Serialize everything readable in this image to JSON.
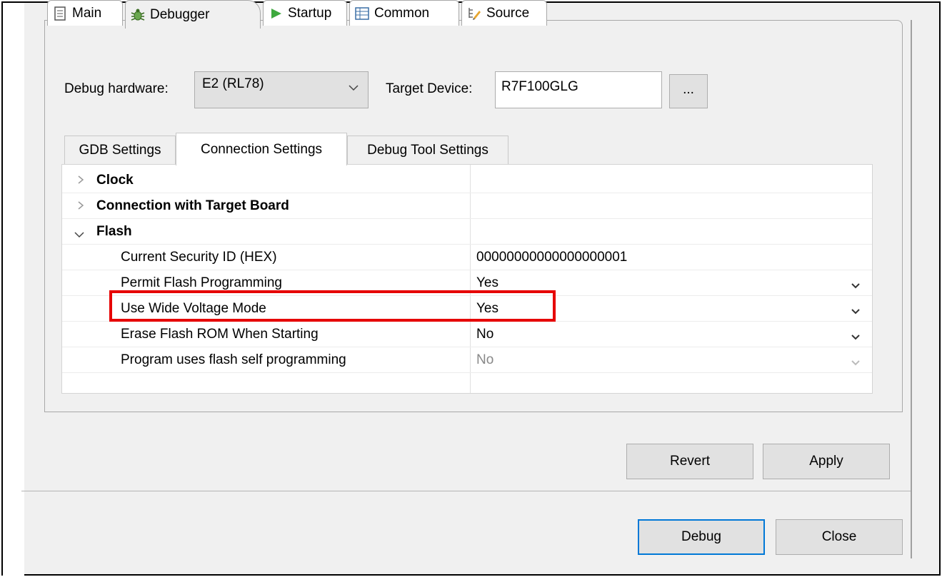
{
  "top_tabs": [
    {
      "label": "Main",
      "icon": "document-icon"
    },
    {
      "label": "Debugger",
      "icon": "bug-icon"
    },
    {
      "label": "Startup",
      "icon": "play-icon"
    },
    {
      "label": "Common",
      "icon": "table-icon"
    },
    {
      "label": "Source",
      "icon": "source-icon"
    }
  ],
  "debug_hardware": {
    "label": "Debug hardware:",
    "value": "E2 (RL78)"
  },
  "target_device": {
    "label": "Target Device:",
    "value": "R7F100GLG",
    "browse_label": "..."
  },
  "sub_tabs": [
    "GDB Settings",
    "Connection Settings",
    "Debug Tool Settings"
  ],
  "settings": {
    "clock": "Clock",
    "connection": "Connection with Target Board",
    "flash": "Flash",
    "rows": [
      {
        "name": "Current Security ID (HEX)",
        "value": "00000000000000000001"
      },
      {
        "name": "Permit Flash Programming",
        "value": "Yes"
      },
      {
        "name": "Use Wide Voltage Mode",
        "value": "Yes"
      },
      {
        "name": "Erase Flash ROM When Starting",
        "value": "No"
      },
      {
        "name": "Program uses flash self programming",
        "value": "No"
      }
    ]
  },
  "buttons": {
    "revert": "Revert",
    "apply": "Apply",
    "debug": "Debug",
    "close": "Close"
  },
  "colors": {
    "highlight": "#e60000",
    "focus": "#0078d7"
  }
}
